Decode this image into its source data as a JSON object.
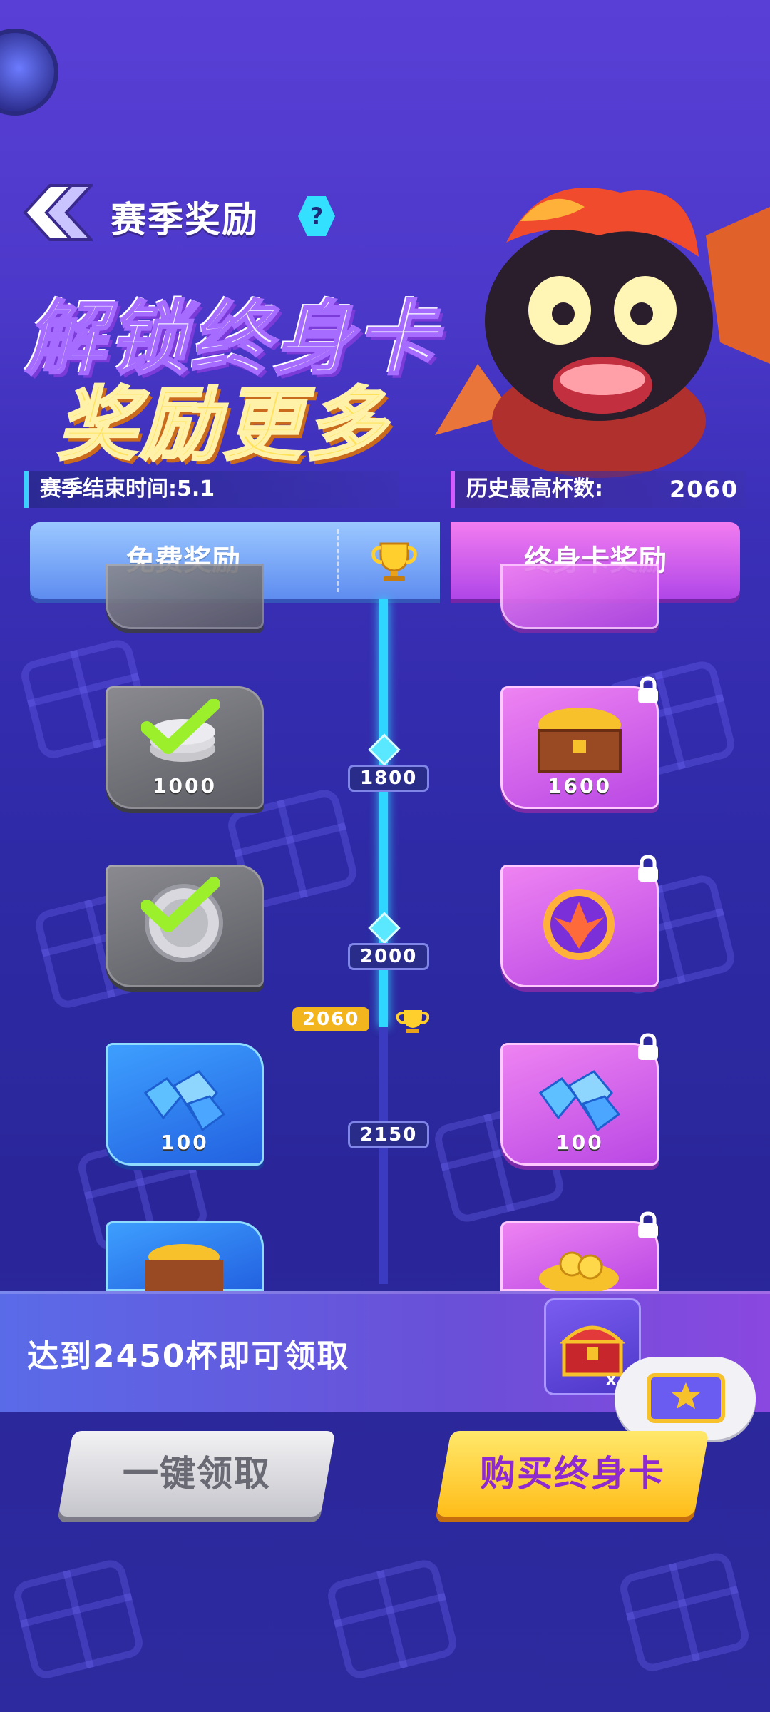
{
  "header": {
    "title": "赛季奖励",
    "help_label": "?",
    "banner_line1": "解锁终身卡",
    "banner_line2": "奖励更多"
  },
  "season": {
    "end_time": "赛季结束时间:5.1",
    "best_trophies_label": "历史最高杯数:",
    "best_trophies_value": "2060"
  },
  "tabs": {
    "free": "免费奖励",
    "lifetime": "终身卡奖励"
  },
  "track": {
    "milestones": [
      "1800",
      "2000",
      "2150"
    ],
    "current": "2060",
    "colors": {
      "active": "#2fd6ff",
      "current": "#f3b51e"
    }
  },
  "rewards": {
    "free": [
      {
        "item": "coin-stack-icon",
        "qty": "1000",
        "state": "claimed"
      },
      {
        "item": "silver-medal-icon",
        "qty": "",
        "state": "claimed"
      },
      {
        "item": "gems-icon",
        "qty": "100",
        "state": "available"
      },
      {
        "item": "treasure-chest-icon",
        "qty": "",
        "state": "available"
      }
    ],
    "lifetime": [
      {
        "item": "treasure-chest-icon",
        "qty": "1600",
        "state": "locked"
      },
      {
        "item": "phoenix-orb-icon",
        "qty": "",
        "state": "locked"
      },
      {
        "item": "gems-icon",
        "qty": "100",
        "state": "locked"
      },
      {
        "item": "coin-pile-icon",
        "qty": "",
        "state": "locked"
      }
    ]
  },
  "next_reward": {
    "text": "达到2450杯即可领取",
    "multiplier": "x"
  },
  "buttons": {
    "claim_all": "一键领取",
    "buy_lifetime": "购买终身卡"
  }
}
